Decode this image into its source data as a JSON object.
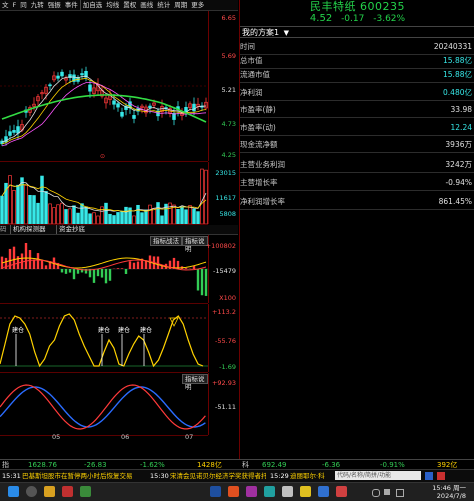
{
  "toolbar": {
    "items": [
      "文",
      "F",
      "同",
      "九转",
      "强振",
      "事件",
      "加自选",
      "均线",
      "置权",
      "画线",
      "统计",
      "周期",
      "更多"
    ]
  },
  "chart": {
    "main_axis": {
      "top": "6.65",
      "mid1": "5.69",
      "mid2": "5.21",
      "low1": "4.73",
      "low2": "4.25"
    },
    "volume_axis": {
      "top": "23015",
      "mid": "11617",
      "low": "5808"
    },
    "vol_tabs": [
      "机构探测器",
      "资金抄底"
    ],
    "macd_axis": {
      "top": "+100802",
      "mid": "-15479",
      "unit": "X100"
    },
    "macd_btn": "指标说明",
    "kdj_axis": {
      "top": "+113.2",
      "mid": "-55.76",
      "bottom": "-1.69"
    },
    "kdj_labels": [
      "建仓",
      "建仓",
      "建仓",
      "建仓"
    ],
    "rsi_axis": {
      "top": "+92.93",
      "mid": "-51.11"
    },
    "rsi_btn": "指标说明",
    "x_labels": [
      "05",
      "06",
      "07"
    ],
    "tab_buttons": [
      "指标战法",
      "指标说明"
    ],
    "price_mark": "⊙"
  },
  "right_panel": {
    "stock_name": "民丰特纸 600235",
    "price": "4.52",
    "change": "-0.17",
    "change_pct": "-3.62%",
    "scheme_label": "我的方案1",
    "rows": [
      {
        "k": "时间",
        "v": "20240331"
      },
      {
        "k": "总市值",
        "v": "15.88亿"
      },
      {
        "k": "流通市值",
        "v": "15.88亿"
      },
      {
        "k": "净利润",
        "v": "0.480亿"
      },
      {
        "k": "市盈率(静)",
        "v": "33.98"
      },
      {
        "k": "市盈率(动)",
        "v": "12.24"
      },
      {
        "k": "现金流净额",
        "v": "3936万"
      },
      {
        "k": "主营业务利润",
        "v": "3242万"
      },
      {
        "k": "主营增长率",
        "v": "-0.94%"
      },
      {
        "k": "净利润增长率",
        "v": "861.45%"
      }
    ]
  },
  "bottom": {
    "index1_name": "指",
    "index1_value": "1628.76",
    "index1_change": "-26.83",
    "index1_pct": "-1.62%",
    "index1_amount": "1428亿",
    "index2_name": "科",
    "index2_value": "692.49",
    "index2_change": "-6.36",
    "index2_pct": "-0.91%",
    "index2_amount": "392亿",
    "news1_time": "15:31",
    "news1_text": "巴基斯坦股市在暂停两小时后恢复交易",
    "news2_time": "15:30",
    "news2_text": "宋清会见诺贝尔经济学奖获得者托马斯·萨金特",
    "news3_time": "15:29",
    "news3_text": "迪丽耶尔·科",
    "search_placeholder": "代码/名称/简拼/功能"
  },
  "taskbar": {
    "time": "15:46 周一",
    "date": "2024/7/8"
  }
}
